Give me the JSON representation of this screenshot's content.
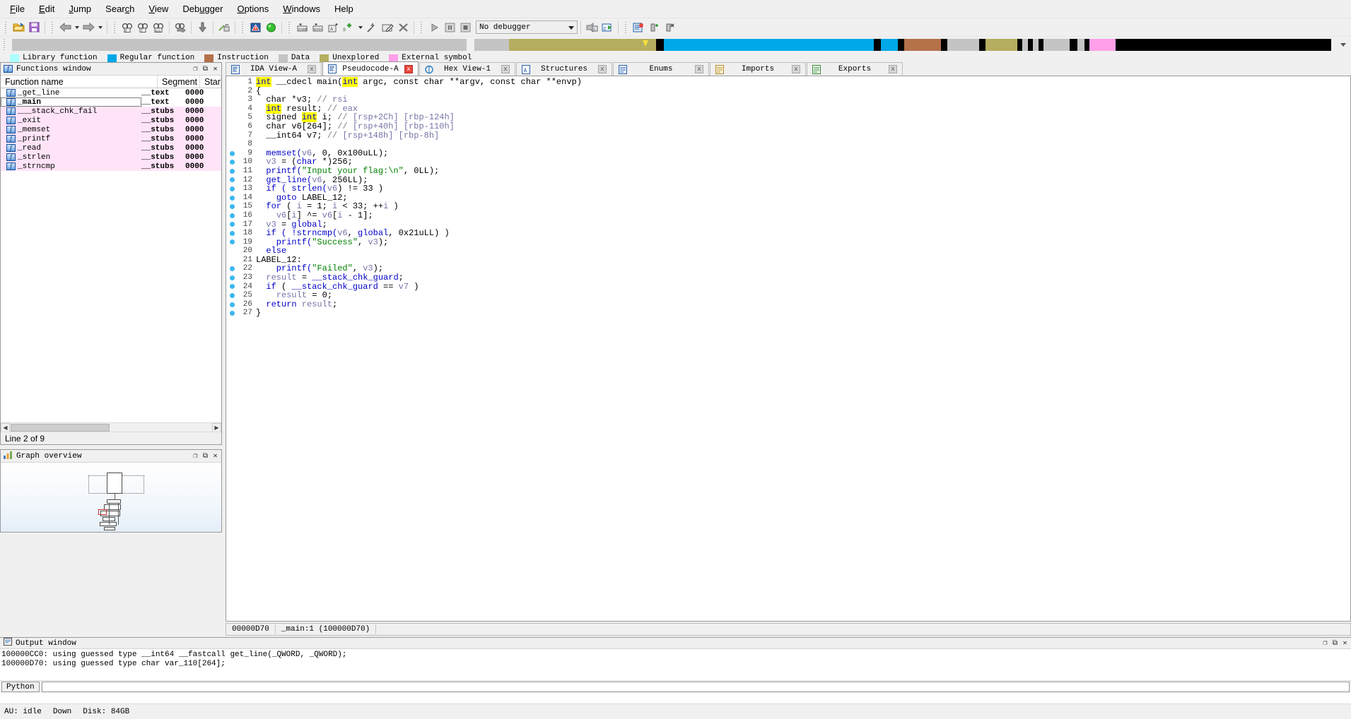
{
  "menu": {
    "items": [
      {
        "label": "File",
        "accel": "F"
      },
      {
        "label": "Edit",
        "accel": "E"
      },
      {
        "label": "Jump",
        "accel": "J"
      },
      {
        "label": "Search",
        "accel": "c"
      },
      {
        "label": "View",
        "accel": "V"
      },
      {
        "label": "Debugger",
        "accel": "u"
      },
      {
        "label": "Options",
        "accel": "O"
      },
      {
        "label": "Windows",
        "accel": "W"
      },
      {
        "label": "Help",
        "accel": ""
      }
    ]
  },
  "toolbar": {
    "debugger_select_value": "No debugger",
    "icons": [
      "open-file-icon",
      "save-icon",
      "navigate-back-icon",
      "back-dropdown-icon",
      "navigate-forward-icon",
      "forward-dropdown-icon",
      "search-hash-icon",
      "search-text-icon",
      "search-number-icon",
      "jump-to-icon",
      "jump-down-icon",
      "unlock-icon",
      "warning-icon",
      "run-green-icon",
      "make-code-icon",
      "make-data-icon",
      "make-ascii-icon",
      "make-struct-icon",
      "struct-dropdown-icon",
      "undefine-icon",
      "edit-icon",
      "delete-icon",
      "run-to-cursor-icon",
      "pause-icon",
      "stop-icon",
      "step-into-c-icon",
      "step-over-c-icon",
      "breakpoint-list-icon",
      "add-breakpoint-icon",
      "delete-breakpoint-icon"
    ]
  },
  "navband": {
    "segments": [
      {
        "color": "#c4c4c4",
        "width_pct": 34.6
      },
      {
        "color": "#f0f0f0",
        "width_pct": 0.6
      },
      {
        "color": "#c4c4c4",
        "width_pct": 2.6
      },
      {
        "color": "#b5ae60",
        "width_pct": 11.2
      },
      {
        "color": "#000000",
        "width_pct": 0.6
      },
      {
        "color": "#00a8e8",
        "width_pct": 16.0
      },
      {
        "color": "#000000",
        "width_pct": 0.5
      },
      {
        "color": "#00a8e8",
        "width_pct": 1.3
      },
      {
        "color": "#000000",
        "width_pct": 0.5
      },
      {
        "color": "#b5714a",
        "width_pct": 2.8
      },
      {
        "color": "#000000",
        "width_pct": 0.5
      },
      {
        "color": "#c4c4c4",
        "width_pct": 2.4
      },
      {
        "color": "#000000",
        "width_pct": 0.5
      },
      {
        "color": "#b5ae60",
        "width_pct": 2.4
      },
      {
        "color": "#000000",
        "width_pct": 0.4
      },
      {
        "color": "#c4c4c4",
        "width_pct": 0.4
      },
      {
        "color": "#000000",
        "width_pct": 0.4
      },
      {
        "color": "#c4c4c4",
        "width_pct": 0.4
      },
      {
        "color": "#000000",
        "width_pct": 0.4
      },
      {
        "color": "#c4c4c4",
        "width_pct": 2.0
      },
      {
        "color": "#000000",
        "width_pct": 0.6
      },
      {
        "color": "#c4c4c4",
        "width_pct": 0.5
      },
      {
        "color": "#000000",
        "width_pct": 0.4
      },
      {
        "color": "#ff9fe8",
        "width_pct": 2.0
      },
      {
        "color": "#000000",
        "width_pct": 16.4
      }
    ],
    "cursor_pct": 48.0
  },
  "legend": {
    "items": [
      {
        "label": "Library function",
        "color": "#aaffff"
      },
      {
        "label": "Regular function",
        "color": "#00a8e8"
      },
      {
        "label": "Instruction",
        "color": "#b5714a"
      },
      {
        "label": "Data",
        "color": "#c4c4c4"
      },
      {
        "label": "Unexplored",
        "color": "#b5ae60"
      },
      {
        "label": "External symbol",
        "color": "#ff9fe8"
      }
    ]
  },
  "functions_window": {
    "title": "Functions window",
    "icon": "function-f-icon",
    "columns": [
      "Function name",
      "Segment",
      "Star"
    ],
    "rows": [
      {
        "name": "_get_line",
        "segment": "__text",
        "start": "0000",
        "library": false,
        "current": false
      },
      {
        "name": "_main",
        "segment": "__text",
        "start": "0000",
        "library": false,
        "current": true
      },
      {
        "name": "___stack_chk_fail",
        "segment": "__stubs",
        "start": "0000",
        "library": true,
        "current": false
      },
      {
        "name": "_exit",
        "segment": "__stubs",
        "start": "0000",
        "library": true,
        "current": false
      },
      {
        "name": "_memset",
        "segment": "__stubs",
        "start": "0000",
        "library": true,
        "current": false
      },
      {
        "name": "_printf",
        "segment": "__stubs",
        "start": "0000",
        "library": true,
        "current": false
      },
      {
        "name": "_read",
        "segment": "__stubs",
        "start": "0000",
        "library": true,
        "current": false
      },
      {
        "name": "_strlen",
        "segment": "__stubs",
        "start": "0000",
        "library": true,
        "current": false
      },
      {
        "name": "_strncmp",
        "segment": "__stubs",
        "start": "0000",
        "library": true,
        "current": false
      }
    ],
    "status": "Line 2 of 9",
    "titlebar_buttons": [
      "minimize-icon",
      "restore-icon",
      "close-icon"
    ]
  },
  "graph_overview": {
    "title": "Graph overview",
    "icon": "graph-icon",
    "titlebar_buttons": [
      "minimize-icon",
      "restore-icon",
      "close-icon"
    ]
  },
  "editor": {
    "tabs": [
      {
        "label": "IDA View-A",
        "icon": "ida-view-icon",
        "active": false,
        "close": "close-tab-icon"
      },
      {
        "label": "Pseudocode-A",
        "icon": "pseudocode-icon",
        "active": true,
        "close": "close-tab-icon"
      },
      {
        "label": "Hex View-1",
        "icon": "hex-view-icon",
        "active": false,
        "close": "close-tab-icon"
      },
      {
        "label": "Structures",
        "icon": "structures-icon",
        "active": false,
        "close": "close-tab-icon"
      },
      {
        "label": "Enums",
        "icon": "enums-icon",
        "active": false,
        "close": "close-tab-icon"
      },
      {
        "label": "Imports",
        "icon": "imports-icon",
        "active": false,
        "close": "close-tab-icon"
      },
      {
        "label": "Exports",
        "icon": "exports-icon",
        "active": false,
        "close": "close-tab-icon"
      }
    ],
    "status_address": "00000D70",
    "status_location": "_main:1 (100000D70)",
    "lines": [
      {
        "n": "1",
        "bp": false,
        "tokens": [
          {
            "t": "int",
            "c": "kwhl"
          },
          {
            "t": " __cdecl main(",
            "c": "pln"
          },
          {
            "t": "int",
            "c": "kwhl"
          },
          {
            "t": " argc, ",
            "c": "pln"
          },
          {
            "t": "const char",
            "c": "pln"
          },
          {
            "t": " **argv, ",
            "c": "pln"
          },
          {
            "t": "const char",
            "c": "pln"
          },
          {
            "t": " **envp)",
            "c": "pln"
          }
        ]
      },
      {
        "n": "2",
        "bp": false,
        "tokens": [
          {
            "t": "{",
            "c": "pln"
          }
        ]
      },
      {
        "n": "3",
        "bp": false,
        "tokens": [
          {
            "t": "  char *v3; ",
            "c": "pln"
          },
          {
            "t": "// ",
            "c": "com"
          },
          {
            "t": "rsi",
            "c": "var"
          }
        ]
      },
      {
        "n": "4",
        "bp": false,
        "tokens": [
          {
            "t": "  ",
            "c": "pln"
          },
          {
            "t": "int",
            "c": "kwhl"
          },
          {
            "t": " result; ",
            "c": "pln"
          },
          {
            "t": "// ",
            "c": "com"
          },
          {
            "t": "eax",
            "c": "var"
          }
        ]
      },
      {
        "n": "5",
        "bp": false,
        "tokens": [
          {
            "t": "  signed ",
            "c": "pln"
          },
          {
            "t": "int",
            "c": "kwhl"
          },
          {
            "t": " i; ",
            "c": "pln"
          },
          {
            "t": "// ",
            "c": "com"
          },
          {
            "t": "[rsp+2Ch] [rbp-124h]",
            "c": "var"
          }
        ]
      },
      {
        "n": "6",
        "bp": false,
        "tokens": [
          {
            "t": "  char v6[264]; ",
            "c": "pln"
          },
          {
            "t": "// ",
            "c": "com"
          },
          {
            "t": "[rsp+40h] [rbp-110h]",
            "c": "var"
          }
        ]
      },
      {
        "n": "7",
        "bp": false,
        "tokens": [
          {
            "t": "  __int64 v7; ",
            "c": "pln"
          },
          {
            "t": "// ",
            "c": "com"
          },
          {
            "t": "[rsp+148h] [rbp-8h]",
            "c": "var"
          }
        ]
      },
      {
        "n": "8",
        "bp": false,
        "tokens": [
          {
            "t": "",
            "c": "pln"
          }
        ]
      },
      {
        "n": "9",
        "bp": true,
        "tokens": [
          {
            "t": "  memset(",
            "c": "fnc"
          },
          {
            "t": "v6",
            "c": "var"
          },
          {
            "t": ", 0, 0x100uLL);",
            "c": "pln"
          }
        ]
      },
      {
        "n": "10",
        "bp": true,
        "tokens": [
          {
            "t": "  ",
            "c": "pln"
          },
          {
            "t": "v3",
            "c": "var"
          },
          {
            "t": " = (",
            "c": "pln"
          },
          {
            "t": "char",
            "c": "kw"
          },
          {
            "t": " *)256;",
            "c": "pln"
          }
        ]
      },
      {
        "n": "11",
        "bp": true,
        "tokens": [
          {
            "t": "  printf(",
            "c": "fnc"
          },
          {
            "t": "\"Input your flag:\\n\"",
            "c": "str"
          },
          {
            "t": ", 0LL);",
            "c": "pln"
          }
        ]
      },
      {
        "n": "12",
        "bp": true,
        "tokens": [
          {
            "t": "  get_line(",
            "c": "fnc"
          },
          {
            "t": "v6",
            "c": "var"
          },
          {
            "t": ", 256LL);",
            "c": "pln"
          }
        ]
      },
      {
        "n": "13",
        "bp": true,
        "tokens": [
          {
            "t": "  ",
            "c": "pln"
          },
          {
            "t": "if",
            "c": "kw"
          },
          {
            "t": " ( strlen(",
            "c": "fnc"
          },
          {
            "t": "v6",
            "c": "var"
          },
          {
            "t": ") != 33 )",
            "c": "pln"
          }
        ]
      },
      {
        "n": "14",
        "bp": true,
        "tokens": [
          {
            "t": "    ",
            "c": "pln"
          },
          {
            "t": "goto",
            "c": "kw"
          },
          {
            "t": " LABEL_12;",
            "c": "pln"
          }
        ]
      },
      {
        "n": "15",
        "bp": true,
        "tokens": [
          {
            "t": "  ",
            "c": "pln"
          },
          {
            "t": "for",
            "c": "kw"
          },
          {
            "t": " ( ",
            "c": "pln"
          },
          {
            "t": "i",
            "c": "var"
          },
          {
            "t": " = 1; ",
            "c": "pln"
          },
          {
            "t": "i",
            "c": "var"
          },
          {
            "t": " < 33; ++",
            "c": "pln"
          },
          {
            "t": "i",
            "c": "var"
          },
          {
            "t": " )",
            "c": "pln"
          }
        ]
      },
      {
        "n": "16",
        "bp": true,
        "tokens": [
          {
            "t": "    ",
            "c": "pln"
          },
          {
            "t": "v6",
            "c": "var"
          },
          {
            "t": "[",
            "c": "pln"
          },
          {
            "t": "i",
            "c": "var"
          },
          {
            "t": "] ^= ",
            "c": "pln"
          },
          {
            "t": "v6",
            "c": "var"
          },
          {
            "t": "[",
            "c": "pln"
          },
          {
            "t": "i",
            "c": "var"
          },
          {
            "t": " - 1];",
            "c": "pln"
          }
        ]
      },
      {
        "n": "17",
        "bp": true,
        "tokens": [
          {
            "t": "  ",
            "c": "pln"
          },
          {
            "t": "v3",
            "c": "var"
          },
          {
            "t": " = ",
            "c": "pln"
          },
          {
            "t": "global",
            "c": "fnc"
          },
          {
            "t": ";",
            "c": "pln"
          }
        ]
      },
      {
        "n": "18",
        "bp": true,
        "tokens": [
          {
            "t": "  ",
            "c": "pln"
          },
          {
            "t": "if",
            "c": "kw"
          },
          {
            "t": " ( !strncmp(",
            "c": "fnc"
          },
          {
            "t": "v6",
            "c": "var"
          },
          {
            "t": ", ",
            "c": "pln"
          },
          {
            "t": "global",
            "c": "fnc"
          },
          {
            "t": ", 0x21uLL) )",
            "c": "pln"
          }
        ]
      },
      {
        "n": "19",
        "bp": true,
        "tokens": [
          {
            "t": "    printf(",
            "c": "fnc"
          },
          {
            "t": "\"Success\"",
            "c": "str"
          },
          {
            "t": ", ",
            "c": "pln"
          },
          {
            "t": "v3",
            "c": "var"
          },
          {
            "t": ");",
            "c": "pln"
          }
        ]
      },
      {
        "n": "20",
        "bp": false,
        "tokens": [
          {
            "t": "  ",
            "c": "pln"
          },
          {
            "t": "else",
            "c": "kw"
          }
        ]
      },
      {
        "n": "21",
        "bp": false,
        "tokens": [
          {
            "t": "LABEL_12:",
            "c": "pln"
          }
        ]
      },
      {
        "n": "22",
        "bp": true,
        "tokens": [
          {
            "t": "    printf(",
            "c": "fnc"
          },
          {
            "t": "\"Failed\"",
            "c": "str"
          },
          {
            "t": ", ",
            "c": "pln"
          },
          {
            "t": "v3",
            "c": "var"
          },
          {
            "t": ");",
            "c": "pln"
          }
        ]
      },
      {
        "n": "23",
        "bp": true,
        "tokens": [
          {
            "t": "  ",
            "c": "pln"
          },
          {
            "t": "result",
            "c": "var"
          },
          {
            "t": " = ",
            "c": "pln"
          },
          {
            "t": "__stack_chk_guard",
            "c": "fnc"
          },
          {
            "t": ";",
            "c": "pln"
          }
        ]
      },
      {
        "n": "24",
        "bp": true,
        "tokens": [
          {
            "t": "  ",
            "c": "pln"
          },
          {
            "t": "if",
            "c": "kw"
          },
          {
            "t": " ( ",
            "c": "pln"
          },
          {
            "t": "__stack_chk_guard",
            "c": "fnc"
          },
          {
            "t": " == ",
            "c": "pln"
          },
          {
            "t": "v7",
            "c": "var"
          },
          {
            "t": " )",
            "c": "pln"
          }
        ]
      },
      {
        "n": "25",
        "bp": true,
        "tokens": [
          {
            "t": "    ",
            "c": "pln"
          },
          {
            "t": "result",
            "c": "var"
          },
          {
            "t": " = 0;",
            "c": "pln"
          }
        ]
      },
      {
        "n": "26",
        "bp": true,
        "tokens": [
          {
            "t": "  ",
            "c": "pln"
          },
          {
            "t": "return",
            "c": "kw"
          },
          {
            "t": " ",
            "c": "pln"
          },
          {
            "t": "result",
            "c": "var"
          },
          {
            "t": ";",
            "c": "pln"
          }
        ]
      },
      {
        "n": "27",
        "bp": true,
        "tokens": [
          {
            "t": "}",
            "c": "pln"
          }
        ]
      }
    ]
  },
  "output_window": {
    "title": "Output window",
    "icon": "output-icon",
    "lines": [
      "100000CC0: using guessed type __int64 __fastcall get_line(_QWORD, _QWORD);",
      "100000D70: using guessed type char var_110[264];"
    ],
    "script_button": "Python",
    "input_value": "",
    "titlebar_buttons": [
      "minimize-icon",
      "restore-icon",
      "close-icon"
    ]
  },
  "statusbar": {
    "au": "AU: idle",
    "down": "Down",
    "disk": "Disk: 84GB"
  }
}
